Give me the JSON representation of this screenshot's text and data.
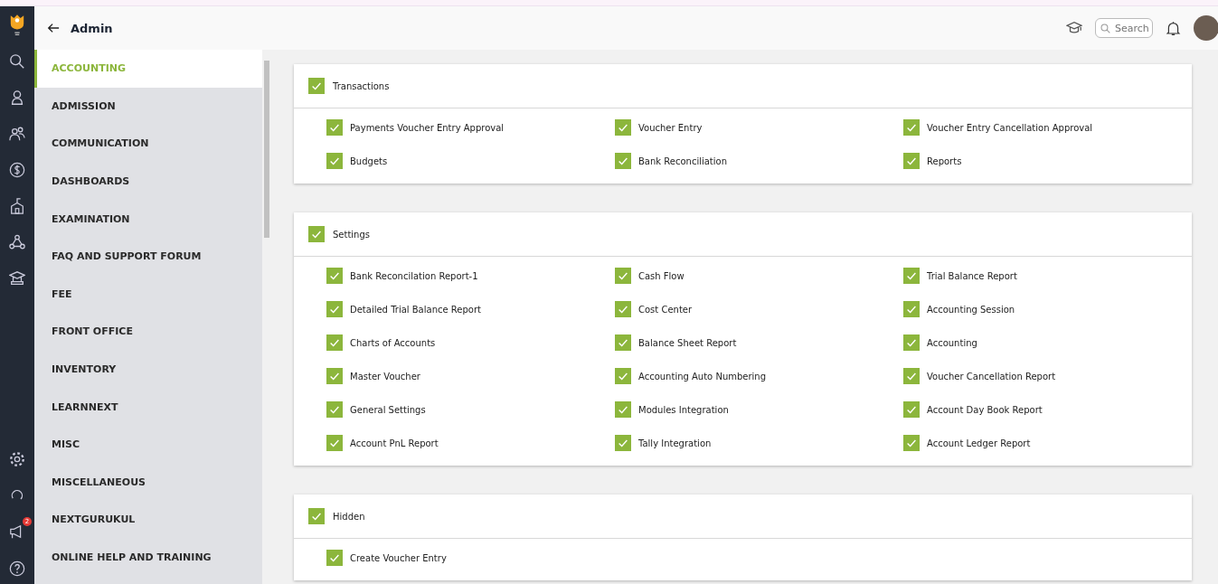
{
  "header": {
    "title": "Admin",
    "search": {
      "placeholder": "Search"
    }
  },
  "rail": {
    "announcement_badge": "2"
  },
  "sidebar": {
    "items": [
      {
        "label": "ACCOUNTING",
        "selected": true
      },
      {
        "label": "ADMISSION",
        "selected": false
      },
      {
        "label": "COMMUNICATION",
        "selected": false
      },
      {
        "label": "DASHBOARDS",
        "selected": false
      },
      {
        "label": "EXAMINATION",
        "selected": false
      },
      {
        "label": "FAQ AND SUPPORT FORUM",
        "selected": false
      },
      {
        "label": "FEE",
        "selected": false
      },
      {
        "label": "FRONT OFFICE",
        "selected": false
      },
      {
        "label": "INVENTORY",
        "selected": false
      },
      {
        "label": "LEARNNEXT",
        "selected": false
      },
      {
        "label": "MISC",
        "selected": false
      },
      {
        "label": "MISCELLANEOUS",
        "selected": false
      },
      {
        "label": "NEXTGURUKUL",
        "selected": false
      },
      {
        "label": "ONLINE HELP AND TRAINING",
        "selected": false
      }
    ]
  },
  "sections": [
    {
      "title": "Transactions",
      "checked": true,
      "items": [
        {
          "label": "Payments Voucher Entry Approval",
          "checked": true
        },
        {
          "label": "Voucher Entry",
          "checked": true
        },
        {
          "label": "Voucher Entry Cancellation Approval",
          "checked": true
        },
        {
          "label": "Budgets",
          "checked": true
        },
        {
          "label": "Bank Reconciliation",
          "checked": true
        },
        {
          "label": "Reports",
          "checked": true
        }
      ]
    },
    {
      "title": "Settings",
      "checked": true,
      "items": [
        {
          "label": "Bank Reconcilation Report-1",
          "checked": true
        },
        {
          "label": "Cash Flow",
          "checked": true
        },
        {
          "label": "Trial Balance Report",
          "checked": true
        },
        {
          "label": "Detailed Trial Balance Report",
          "checked": true
        },
        {
          "label": "Cost Center",
          "checked": true
        },
        {
          "label": "Accounting Session",
          "checked": true
        },
        {
          "label": "Charts of Accounts",
          "checked": true
        },
        {
          "label": "Balance Sheet Report",
          "checked": true
        },
        {
          "label": "Accounting",
          "checked": true
        },
        {
          "label": "Master Voucher",
          "checked": true
        },
        {
          "label": "Accounting Auto Numbering",
          "checked": true
        },
        {
          "label": "Voucher Cancellation Report",
          "checked": true
        },
        {
          "label": "General Settings",
          "checked": true
        },
        {
          "label": "Modules Integration",
          "checked": true
        },
        {
          "label": "Account Day Book Report",
          "checked": true
        },
        {
          "label": "Account PnL Report",
          "checked": true
        },
        {
          "label": "Tally Integration",
          "checked": true
        },
        {
          "label": "Account Ledger Report",
          "checked": true
        }
      ]
    },
    {
      "title": "Hidden",
      "checked": true,
      "items": [
        {
          "label": "Create Voucher Entry",
          "checked": true
        }
      ]
    }
  ]
}
